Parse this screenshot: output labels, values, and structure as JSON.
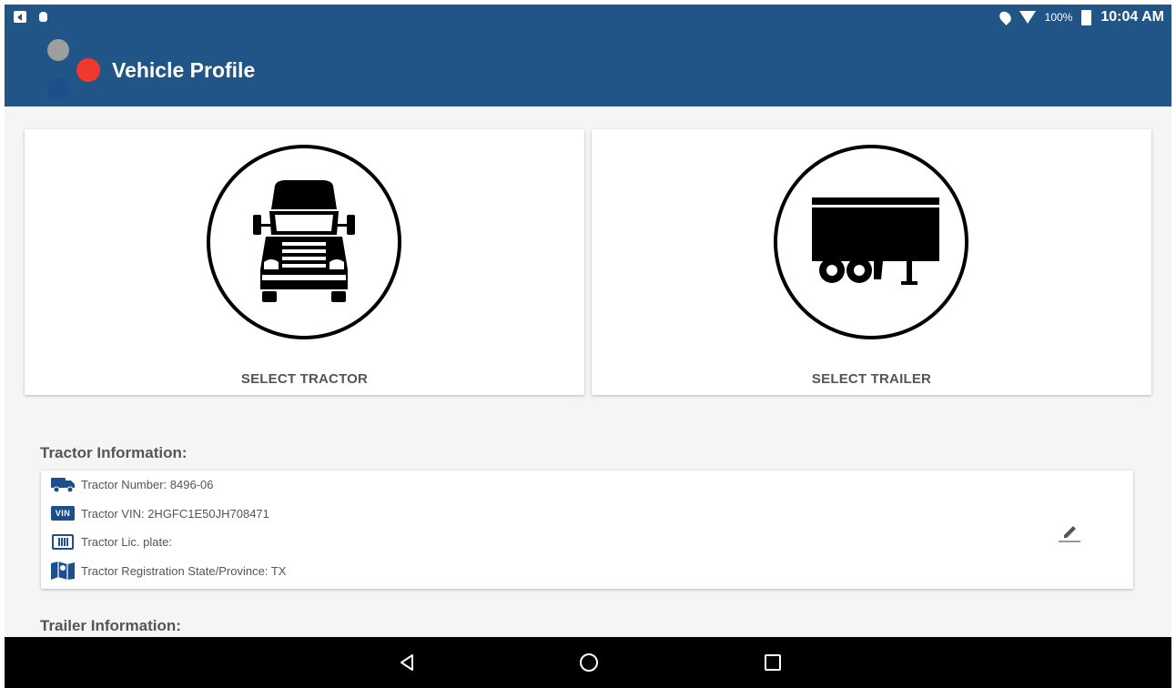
{
  "status_bar": {
    "battery_percent": "100%",
    "time": "10:04 AM"
  },
  "app_bar": {
    "title": "Vehicle Profile"
  },
  "cards": {
    "tractor_label": "SELECT TRACTOR",
    "trailer_label": "SELECT TRAILER"
  },
  "tractor_info": {
    "heading": "Tractor Information:",
    "number": "Tractor Number: 8496-06",
    "vin_badge": "VIN",
    "vin": "Tractor VIN: 2HGFC1E50JH708471",
    "plate": "Tractor Lic. plate:",
    "registration": "Tractor Registration State/Province: TX"
  },
  "trailer_info": {
    "heading": "Trailer Information:"
  },
  "icons": {
    "edit": "edit-icon",
    "back": "back-icon",
    "home": "home-icon",
    "recent": "recent-apps-icon"
  },
  "colors": {
    "app_bar": "#215587",
    "accent_icon": "#1c4f8c",
    "logo_red": "#f0392b",
    "logo_gray": "#9e9e9e"
  }
}
